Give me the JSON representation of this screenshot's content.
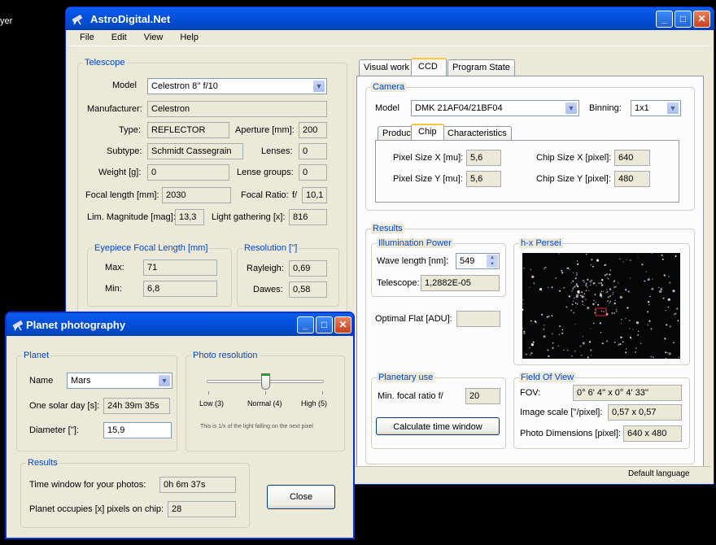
{
  "desktop": {
    "left_text": "yer"
  },
  "main_window": {
    "title": "AstroDigital.Net",
    "menu": [
      "File",
      "Edit",
      "View",
      "Help"
    ],
    "telescope": {
      "group_label": "Telescope",
      "model_label": "Model",
      "model_value": "Celestron 8'' f/10",
      "manufacturer_label": "Manufacturer:",
      "manufacturer_value": "Celestron",
      "type_label": "Type:",
      "type_value": "REFLECTOR",
      "aperture_label": "Aperture [mm]:",
      "aperture_value": "200",
      "subtype_label": "Subtype:",
      "subtype_value": "Schmidt Cassegrain",
      "lenses_label": "Lenses:",
      "lenses_value": "0",
      "weight_label": "Weight [g]:",
      "weight_value": "0",
      "lense_groups_label": "Lense groups:",
      "lense_groups_value": "0",
      "focal_length_label": "Focal length [mm]:",
      "focal_length_value": "2030",
      "focal_ratio_label": "Focal Ratio:",
      "focal_ratio_prefix": "f/",
      "focal_ratio_value": "10,1",
      "lim_mag_label": "Lim. Magnitude [mag]:",
      "lim_mag_value": "13,3",
      "light_gathering_label": "Light gathering [x]:",
      "light_gathering_value": "816",
      "eyepiece": {
        "group_label": "Eyepiece Focal Length [mm]",
        "max_label": "Max:",
        "max_value": "71",
        "min_label": "Min:",
        "min_value": "6,8"
      },
      "resolution": {
        "group_label": "Resolution ['']",
        "rayleigh_label": "Rayleigh:",
        "rayleigh_value": "0,69",
        "dawes_label": "Dawes:",
        "dawes_value": "0,58"
      }
    },
    "tabs": [
      "Visual work",
      "CCD",
      "Program State"
    ],
    "camera": {
      "group_label": "Camera",
      "model_label": "Model",
      "model_value": "DMK 21AF04/21BF04",
      "binning_label": "Binning:",
      "binning_value": "1x1",
      "subtabs": [
        "Product",
        "Chip",
        "Characteristics"
      ],
      "pixel_x_label": "Pixel Size X [mu]:",
      "pixel_x_value": "5,6",
      "pixel_y_label": "Pixel Size Y [mu]:",
      "pixel_y_value": "5,6",
      "chip_x_label": "Chip Size X [pixel]:",
      "chip_x_value": "640",
      "chip_y_label": "Chip Size Y [pixel]:",
      "chip_y_value": "480"
    },
    "results": {
      "group_label": "Results",
      "illumination": {
        "group_label": "Illumination Power",
        "wave_label": "Wave length [nm]:",
        "wave_value": "549",
        "telescope_label": "Telescope:",
        "telescope_value": "1,2882E-05"
      },
      "optimal_flat_label": "Optimal Flat [ADU]:",
      "optimal_flat_value": "",
      "image_group_label": "h-x Persei",
      "planetary": {
        "group_label": "Planetary use",
        "min_focal_label": "Min. focal ratio f/",
        "min_focal_value": "20",
        "calc_button": "Calculate time window"
      },
      "fov": {
        "group_label": "Field Of View",
        "fov_label": "FOV:",
        "fov_value": "0° 6' 4''  x 0° 4' 33''",
        "scale_label": "Image scale [''/pixel]:",
        "scale_value": "0,57 x 0,57",
        "dims_label": "Photo Dimensions [pixel]:",
        "dims_value": "640 x 480"
      }
    },
    "status_text": "Default language"
  },
  "planet_window": {
    "title": "Planet photography",
    "planet": {
      "group_label": "Planet",
      "name_label": "Name",
      "name_value": "Mars",
      "solar_day_label": "One solar day [s]:",
      "solar_day_value": "24h 39m 35s",
      "diameter_label": "Diameter ['']:",
      "diameter_value": "15,9"
    },
    "photo_resolution": {
      "group_label": "Photo resolution",
      "low": "Low (3)",
      "normal": "Normal (4)",
      "high": "High (5)",
      "slider_level": 0.5,
      "note": "This is 1/x of the light falling on the next pixel"
    },
    "results": {
      "group_label": "Results",
      "time_window_label": "Time window for your photos:",
      "time_window_value": "0h 6m 37s",
      "pixels_label": "Planet occupies [x] pixels on chip:",
      "pixels_value": "28"
    },
    "close_button": "Close"
  }
}
